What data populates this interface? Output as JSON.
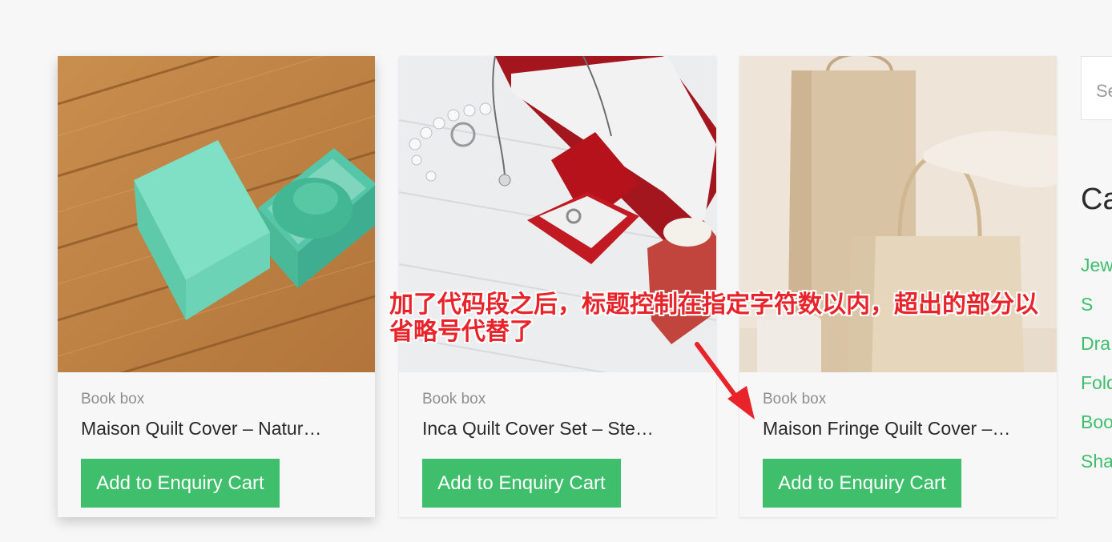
{
  "products": [
    {
      "category": "Book box",
      "title": "Maison Quilt Cover – Natur…",
      "button_label": "Add to Enquiry Cart",
      "image": "teal-gift-box-on-wood"
    },
    {
      "category": "Book box",
      "title": "Inca Quilt Cover Set – Ste…",
      "button_label": "Add to Enquiry Cart",
      "image": "red-velvet-ring-box"
    },
    {
      "category": "Book box",
      "title": "Maison Fringe Quilt Cover –…",
      "button_label": "Add to Enquiry Cart",
      "image": "kraft-paper-bags"
    }
  ],
  "sidebar": {
    "search_placeholder": "Se",
    "categories_heading": "Ca",
    "links": [
      "Jew",
      "S",
      "Dra",
      "Fold",
      "Boo",
      "Sha"
    ]
  },
  "annotation": {
    "line1": "加了代码段之后，标题控制在指定字符数以内，超出的部分以",
    "line2": "省略号代替了"
  },
  "colors": {
    "accent_green": "#3fbf6c",
    "annotation_red": "#e8232a",
    "page_background": "#f7f7f7"
  }
}
